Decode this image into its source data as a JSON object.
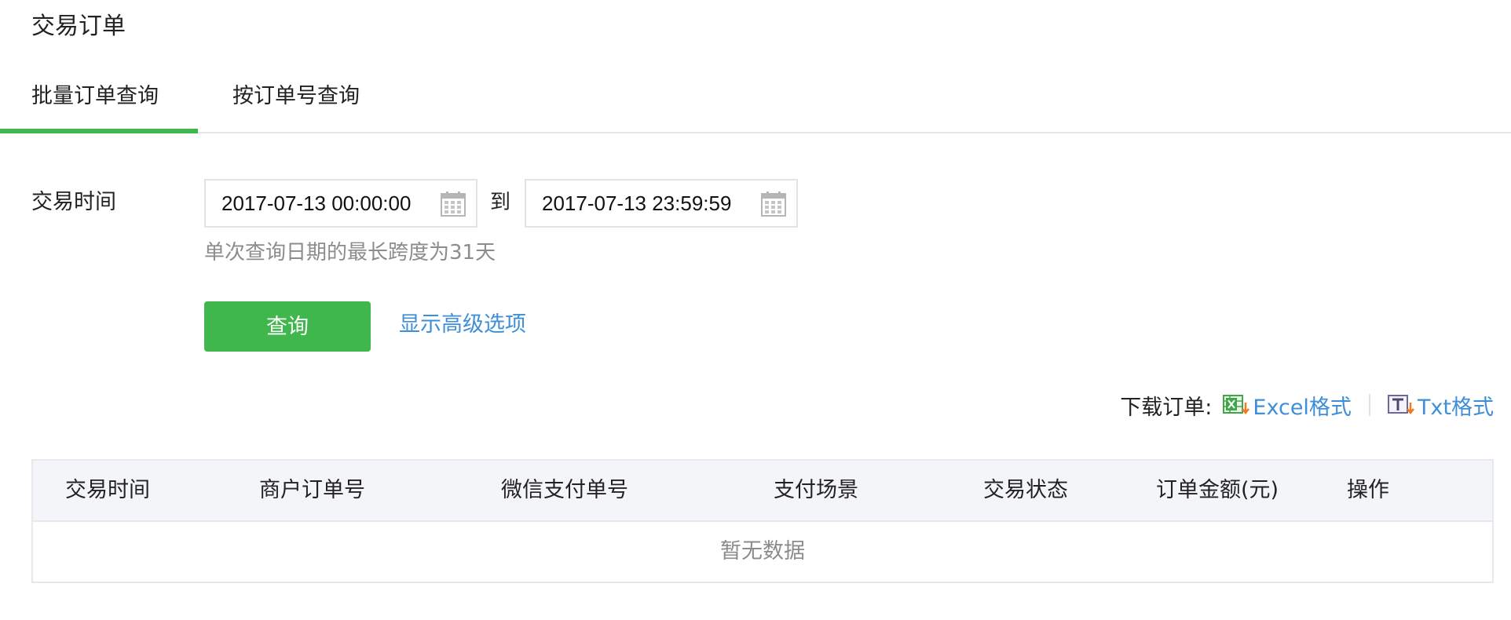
{
  "page": {
    "title": "交易订单"
  },
  "tabs": [
    {
      "label": "批量订单查询",
      "active": true
    },
    {
      "label": "按订单号查询",
      "active": false
    }
  ],
  "filter": {
    "time_label": "交易时间",
    "start_time": "2017-07-13 00:00:00",
    "to_label": "到",
    "end_time": "2017-07-13 23:59:59",
    "hint": "单次查询日期的最长跨度为31天",
    "query_button": "查询",
    "advanced_link": "显示高级选项"
  },
  "download": {
    "label": "下载订单:",
    "excel_label": "Excel格式",
    "txt_label": "Txt格式",
    "excel_icon": "excel-download-icon",
    "txt_icon": "txt-download-icon"
  },
  "table": {
    "columns": [
      "交易时间",
      "商户订单号",
      "微信支付单号",
      "支付场景",
      "交易状态",
      "订单金额(元)",
      "操作"
    ],
    "empty_text": "暂无数据"
  },
  "colors": {
    "accent_green": "#3fb74c",
    "link_blue": "#3f8fd8",
    "hint_gray": "#8c8c8c",
    "table_header_bg": "#f4f5f9"
  }
}
